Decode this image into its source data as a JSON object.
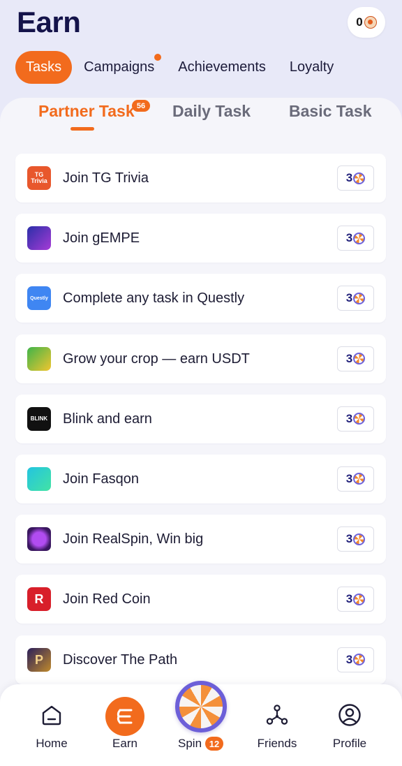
{
  "header": {
    "title": "Earn",
    "balance": "0",
    "balance_icon": "coin-icon"
  },
  "top_tabs": [
    {
      "label": "Tasks",
      "active": true
    },
    {
      "label": "Campaigns",
      "active": false,
      "has_dot": true
    },
    {
      "label": "Achievements",
      "active": false
    },
    {
      "label": "Loyalty",
      "active": false
    }
  ],
  "sub_tabs": [
    {
      "label": "Partner Task",
      "active": true,
      "badge": "56"
    },
    {
      "label": "Daily Task",
      "active": false
    },
    {
      "label": "Basic Task",
      "active": false
    }
  ],
  "tasks": [
    {
      "label": "Join TG Trivia",
      "reward": "3",
      "icon": "tg-trivia-icon",
      "icon_text": "TG Trivia"
    },
    {
      "label": "Join gEMPE",
      "reward": "3",
      "icon": "gempe-icon",
      "icon_text": ""
    },
    {
      "label": "Complete any task in Questly",
      "reward": "3",
      "icon": "questly-icon",
      "icon_text": "Questly"
    },
    {
      "label": "Grow your crop — earn USDT",
      "reward": "3",
      "icon": "crop-icon",
      "icon_text": ""
    },
    {
      "label": "Blink and earn",
      "reward": "3",
      "icon": "blink-icon",
      "icon_text": "BLINK"
    },
    {
      "label": "Join Fasqon",
      "reward": "3",
      "icon": "fasqon-icon",
      "icon_text": ""
    },
    {
      "label": "Join RealSpin, Win big",
      "reward": "3",
      "icon": "realspin-icon",
      "icon_text": ""
    },
    {
      "label": "Join Red Coin",
      "reward": "3",
      "icon": "red-coin-icon",
      "icon_text": "R"
    },
    {
      "label": "Discover The Path",
      "reward": "3",
      "icon": "the-path-icon",
      "icon_text": "P"
    }
  ],
  "bottom_nav": {
    "home": "Home",
    "earn": "Earn",
    "spin": "Spin",
    "spin_badge": "12",
    "friends": "Friends",
    "profile": "Profile"
  },
  "colors": {
    "accent": "#f26b1d",
    "background": "#e8e9f8",
    "title": "#14134a"
  }
}
